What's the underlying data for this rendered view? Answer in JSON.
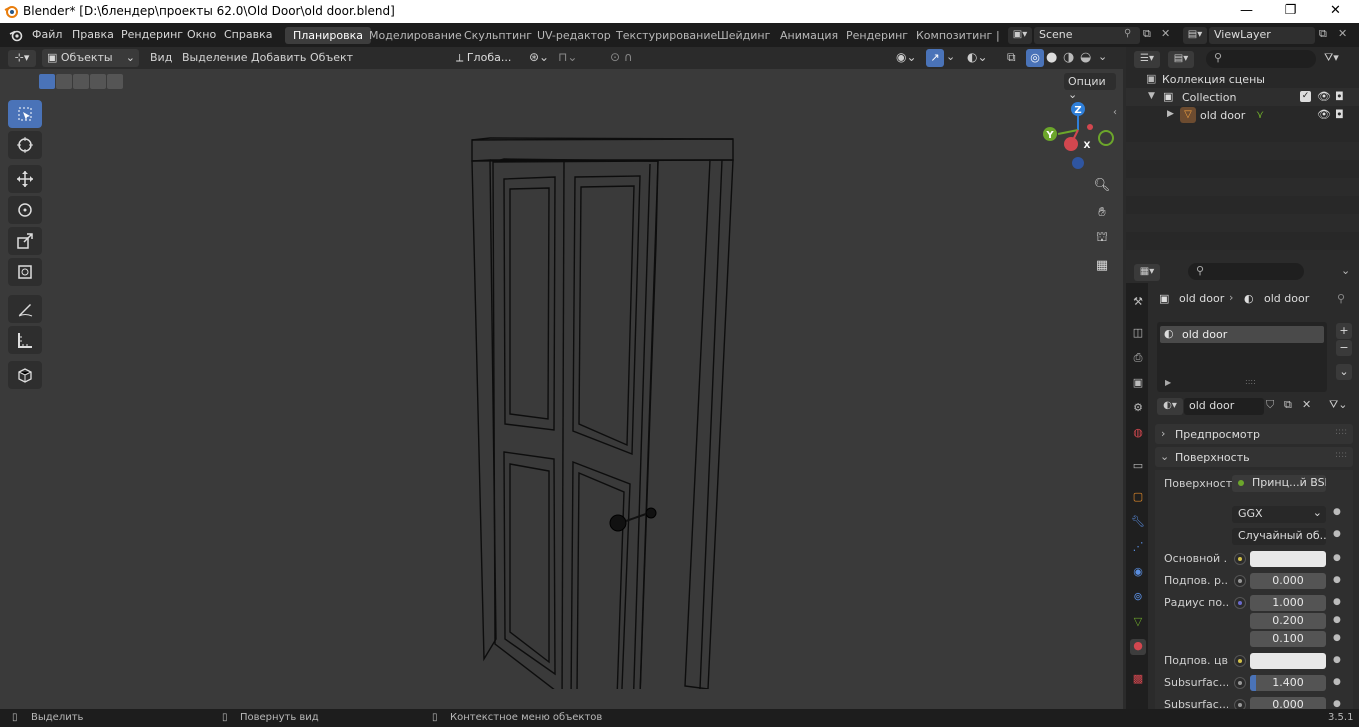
{
  "window": {
    "title": "Blender* [D:\\блендер\\проекты 62.0\\Old Door\\old door.blend]",
    "minimize": "—",
    "maximize": "❐",
    "close": "✕"
  },
  "menu": {
    "items": [
      "Файл",
      "Правка",
      "Рендеринг",
      "Окно",
      "Справка"
    ]
  },
  "workspaces": {
    "tabs": [
      "Планировка",
      "Моделирование",
      "Скульптинг",
      "UV-редактор",
      "Текстурирование",
      "Шейдинг",
      "Анимация",
      "Рендеринг",
      "Композитинг"
    ],
    "active": "Планировка",
    "more": "|"
  },
  "scene": {
    "label": "Scene",
    "view_layer": "ViewLayer"
  },
  "viewport_header": {
    "mode": "Объекты",
    "menus": [
      "Вид",
      "Выделение",
      "Добавить",
      "Объект"
    ],
    "transform_orientation": "Глоба...",
    "options": "Опции"
  },
  "gizmo": {
    "z": "Z",
    "y": "Y",
    "x": "X"
  },
  "outliner": {
    "root": "Коллекция сцены",
    "collection": "Collection",
    "object": "old door"
  },
  "properties": {
    "breadcrumb_object": "old door",
    "breadcrumb_material": "old door",
    "slot": "old door",
    "material_name": "old door",
    "panels": {
      "preview": "Предпросмотр",
      "surface": "Поверхность"
    },
    "surface_label": "Поверхность",
    "surface_value": "Принц...й BSDF",
    "distribution": "GGX",
    "subsurface_method": "Случайный об...",
    "rows": [
      {
        "label": "Основной ...",
        "value": "",
        "color": "#e8e8e8",
        "dot": "#d4c24a"
      },
      {
        "label": "Подпов. р...",
        "value": "0.000",
        "color": "",
        "dot": "#9a9a9a"
      },
      {
        "label": "Радиус по...",
        "value": "1.000",
        "color": "",
        "dot": "#6a6acd"
      },
      {
        "label": "",
        "value": "0.200",
        "color": "",
        "dot": ""
      },
      {
        "label": "",
        "value": "0.100",
        "color": "",
        "dot": ""
      },
      {
        "label": "Подпов. цв...",
        "value": "",
        "color": "#e8e8e8",
        "dot": "#d4c24a"
      },
      {
        "label": "Subsurfac...",
        "value": "1.400",
        "color": "",
        "dot": "#9a9a9a"
      },
      {
        "label": "Subsurfac...",
        "value": "0.000",
        "color": "",
        "dot": "#9a9a9a"
      }
    ]
  },
  "statusbar": {
    "select": "Выделить",
    "rotate": "Повернуть вид",
    "context": "Контекстное меню объектов",
    "version": "3.5.1"
  },
  "colors": {
    "accent": "#4a73b8",
    "x_axis": "#d2474f",
    "y_axis": "#6ca62b",
    "z_axis": "#2f7fd9"
  }
}
